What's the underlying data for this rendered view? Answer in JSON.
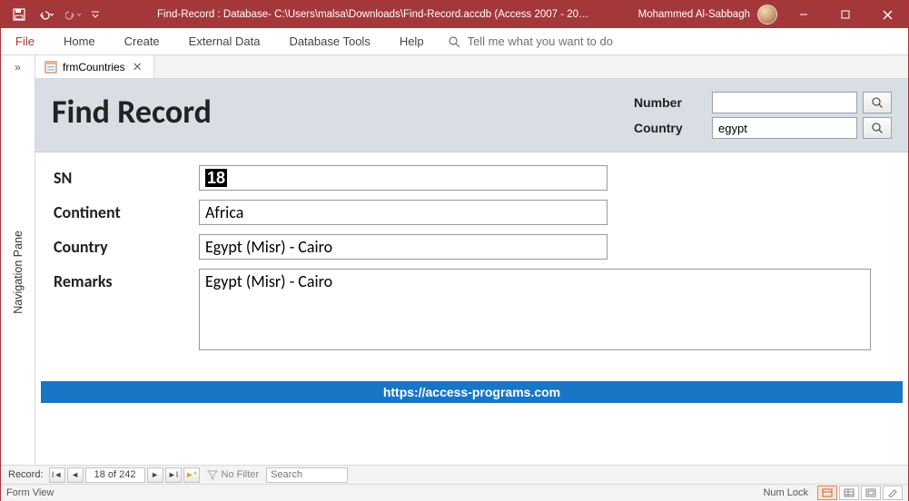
{
  "titlebar": {
    "title": "Find-Record : Database- C:\\Users\\malsa\\Downloads\\Find-Record.accdb (Access 2007 - 20…",
    "user": "Mohammed Al-Sabbagh"
  },
  "menu": {
    "file": "File",
    "home": "Home",
    "create": "Create",
    "external": "External Data",
    "dbtools": "Database Tools",
    "help": "Help",
    "tellme": "Tell me what you want to do"
  },
  "navpane": {
    "label": "Navigation Pane"
  },
  "tab": {
    "name": "frmCountries"
  },
  "form": {
    "title": "Find Record",
    "search": {
      "number_label": "Number",
      "number_value": "",
      "country_label": "Country",
      "country_value": "egypt"
    },
    "fields": {
      "sn_label": "SN",
      "sn_value": "18",
      "continent_label": "Continent",
      "continent_value": "Africa",
      "country_label": "Country",
      "country_value": "Egypt (Misr) - Cairo",
      "remarks_label": "Remarks",
      "remarks_value": "Egypt (Misr) - Cairo"
    },
    "footer_link": "https://access-programs.com"
  },
  "recordnav": {
    "label": "Record:",
    "counter": "18 of 242",
    "filter": "No Filter",
    "search_placeholder": "Search"
  },
  "statusbar": {
    "left": "Form View",
    "numlock": "Num Lock"
  }
}
